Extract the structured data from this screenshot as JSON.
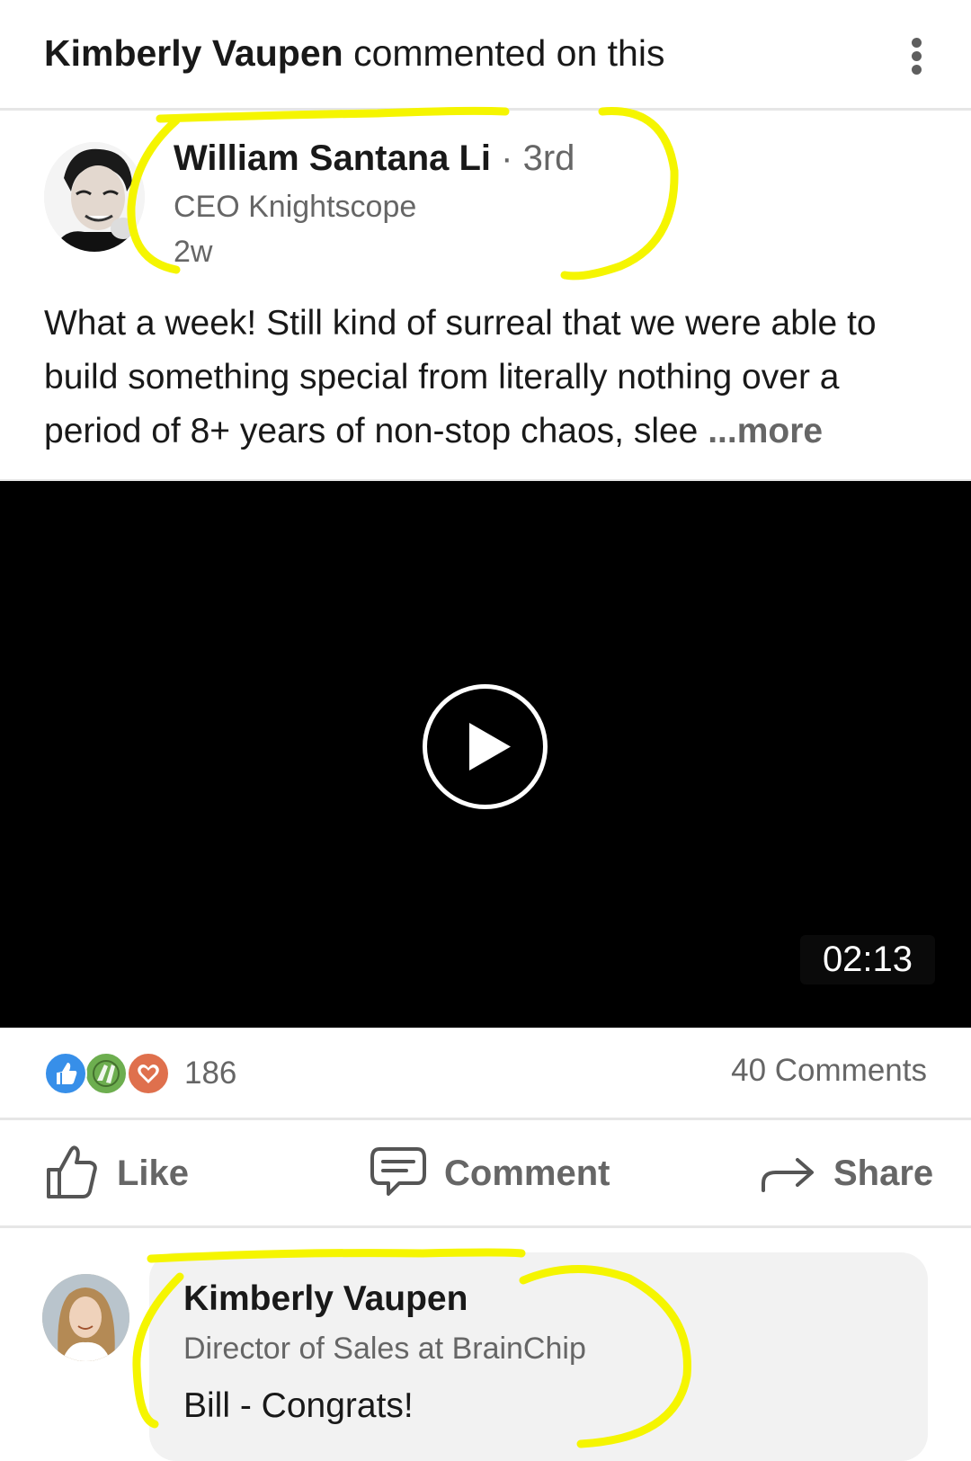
{
  "header": {
    "actor_name": "Kimberly Vaupen",
    "action_text": " commented on this",
    "menu_icon": "overflow-vertical-dots-icon"
  },
  "post": {
    "author": {
      "name": "William Santana Li",
      "degree": " · 3rd",
      "headline": "CEO Knightscope",
      "time": "2w"
    },
    "text": "What a week!  Still kind of surreal that we were able to build something special from literally nothing over a period of 8+ years of non-stop chaos, slee ",
    "more_label": "...more",
    "video": {
      "duration": "02:13",
      "play_icon": "play-circle-icon"
    },
    "reactions": {
      "icons": [
        "like-reaction-icon",
        "celebrate-reaction-icon",
        "love-reaction-icon"
      ],
      "count": "186"
    },
    "comments_count": "40 Comments"
  },
  "actions": {
    "like_label": "Like",
    "comment_label": "Comment",
    "share_label": "Share"
  },
  "comment": {
    "author_name": "Kimberly Vaupen",
    "author_headline": "Director of Sales at BrainChip",
    "text": "Bill - Congrats!"
  },
  "colors": {
    "text_primary": "#191919",
    "text_secondary": "#666666",
    "like_blue": "#378fe9",
    "celebrate_green": "#44712e",
    "love_red": "#df704d",
    "annotation_yellow": "#f5f500",
    "video_bg": "#000000"
  }
}
